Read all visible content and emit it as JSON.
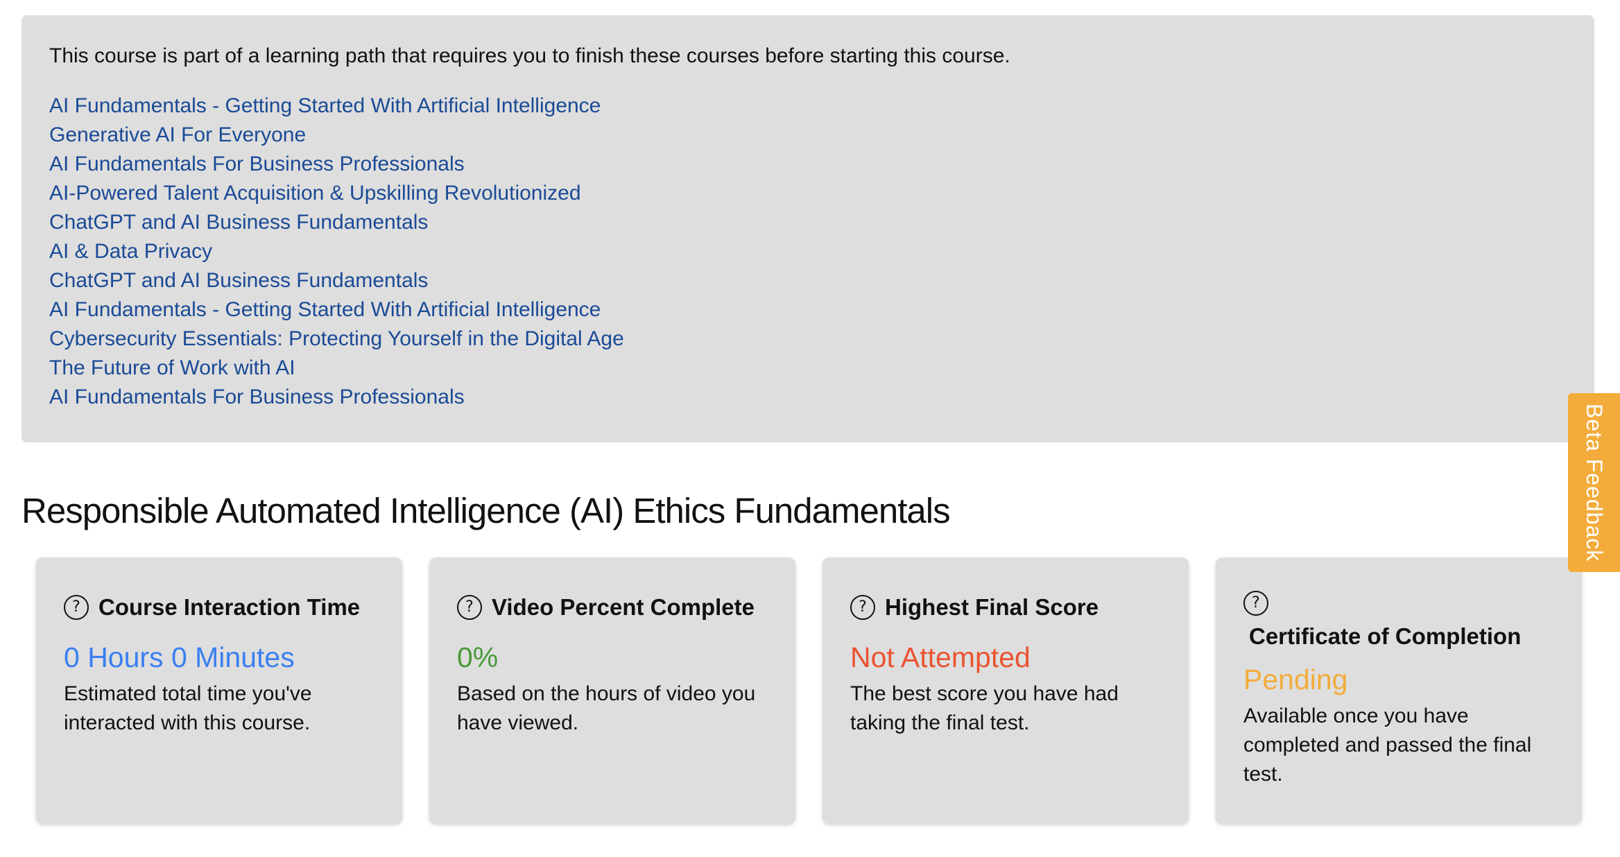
{
  "prerequisites": {
    "intro": "This course is part of a learning path that requires you to finish these courses before starting this course.",
    "courses": [
      "AI Fundamentals - Getting Started With Artificial Intelligence",
      "Generative AI For Everyone",
      "AI Fundamentals For Business Professionals",
      "AI-Powered Talent Acquisition & Upskilling Revolutionized",
      "ChatGPT and AI Business Fundamentals",
      "AI & Data Privacy",
      "ChatGPT and AI Business Fundamentals",
      "AI Fundamentals - Getting Started With Artificial Intelligence",
      "Cybersecurity Essentials: Protecting Yourself in the Digital Age",
      "The Future of Work with AI",
      "AI Fundamentals For Business Professionals"
    ]
  },
  "course": {
    "title": "Responsible Automated Intelligence (AI) Ethics Fundamentals"
  },
  "stats": {
    "interaction_time": {
      "icon": "help-icon",
      "help": "?",
      "title": "Course Interaction Time",
      "value": "0 Hours 0 Minutes",
      "value_color": "#3a7ff0",
      "description": "Estimated total time you've interacted with this course."
    },
    "video_percent": {
      "icon": "help-icon",
      "help": "?",
      "title": "Video Percent Complete",
      "value": "0%",
      "value_color": "#4a9a3a",
      "description": "Based on the hours of video you have viewed."
    },
    "final_score": {
      "icon": "help-icon",
      "help": "?",
      "title": "Highest Final Score",
      "value": "Not Attempted",
      "value_color": "#ea5331",
      "description": "The best score you have had taking the final test."
    },
    "certificate": {
      "icon": "help-icon",
      "help": "?",
      "title": "Certificate of Completion",
      "value": "Pending",
      "value_color": "#f3ac3b",
      "description": "Available once you have completed and passed the final test."
    }
  },
  "beta_feedback": {
    "label": "Beta Feedback",
    "color": "#f3ac3b"
  },
  "colors": {
    "link": "#1a4a96",
    "panel": "#dedede"
  }
}
